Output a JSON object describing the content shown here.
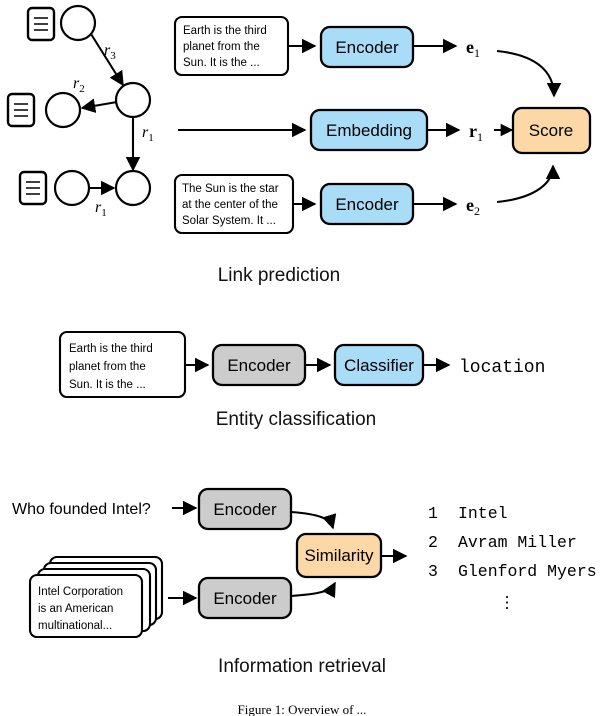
{
  "figure": {
    "caption_partial": "Figure 1:  Overview of ...",
    "sections": [
      {
        "id": "link-prediction",
        "caption": "Link prediction"
      },
      {
        "id": "entity-classification",
        "caption": "Entity classification"
      },
      {
        "id": "information-retrieval",
        "caption": "Information retrieval"
      }
    ]
  },
  "colors": {
    "blue": "#a9dcf6",
    "orange": "#fbd8a5",
    "gray": "#cccccc",
    "white": "#ffffff",
    "outline": "#000000"
  },
  "link_prediction": {
    "caption": "Link prediction",
    "graph": {
      "edges": [
        {
          "label": "r",
          "sub": "3"
        },
        {
          "label": "r",
          "sub": "2"
        },
        {
          "label": "r",
          "sub": "1"
        },
        {
          "label": "r",
          "sub": "1"
        }
      ],
      "edge_labels": [
        "r3",
        "r2",
        "r1",
        "r1"
      ],
      "node_count": 5,
      "doc_icon_count": 3
    },
    "text_box_top": {
      "lines": [
        "Earth is the third",
        "planet from the",
        "Sun. It is the ..."
      ]
    },
    "text_box_bottom": {
      "lines": [
        "The Sun is the star",
        "at the center of the",
        "Solar System. It ..."
      ]
    },
    "blocks": {
      "encoder_top": "Encoder",
      "embedding": "Embedding",
      "encoder_bottom": "Encoder",
      "score": "Score"
    },
    "vectors": {
      "e1": {
        "symbol": "e",
        "sub": "1"
      },
      "r1": {
        "symbol": "r",
        "sub": "1"
      },
      "e2": {
        "symbol": "e",
        "sub": "2"
      }
    }
  },
  "entity_classification": {
    "caption": "Entity classification",
    "text_box": {
      "lines": [
        "Earth is the third",
        "planet from the",
        "Sun. It is the ..."
      ]
    },
    "blocks": {
      "encoder": "Encoder",
      "classifier": "Classifier"
    },
    "output": "location"
  },
  "information_retrieval": {
    "caption": "Information retrieval",
    "query": "Who founded Intel?",
    "document_stack": {
      "lines": [
        "Intel Corporation",
        "is an American",
        "multinational..."
      ],
      "layers": 4
    },
    "blocks": {
      "encoder_query": "Encoder",
      "encoder_docs": "Encoder",
      "similarity": "Similarity"
    },
    "results": [
      {
        "rank": "1",
        "text": "Intel"
      },
      {
        "rank": "2",
        "text": "Avram Miller"
      },
      {
        "rank": "3",
        "text": "Glenford Myers"
      }
    ],
    "ellipsis": "⋮"
  }
}
